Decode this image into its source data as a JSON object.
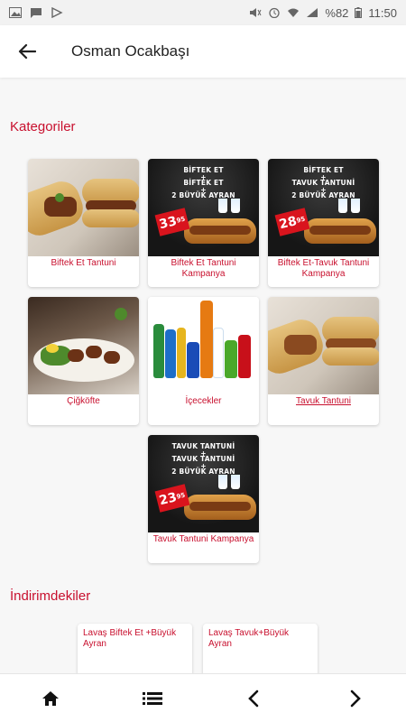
{
  "status_bar": {
    "battery_text": "%82",
    "time": "11:50",
    "left_icons": [
      "image-icon",
      "message-icon",
      "play-store-icon"
    ],
    "right_icons": [
      "mute-icon",
      "alarm-icon",
      "wifi-icon",
      "signal-icon",
      "battery-icon"
    ]
  },
  "app_bar": {
    "title": "Osman Ocakbaşı",
    "back_icon": "back-arrow-icon"
  },
  "categories": {
    "title": "Kategoriler",
    "items": [
      {
        "label": "Biftek Et Tantuni",
        "image": "wrap-and-sandwich-photo"
      },
      {
        "label": "Biftek Et Tantuni Kampanya",
        "image": "promo-poster",
        "promo": {
          "lines": [
            "BİFTEK ET",
            "+",
            "BİFTEK ET",
            "+",
            "2 BÜYÜK AYRAN"
          ],
          "price": "33",
          "price_cents": "95"
        }
      },
      {
        "label": "Biftek Et-Tavuk Tantuni Kampanya",
        "image": "promo-poster",
        "promo": {
          "lines": [
            "BİFTEK ET",
            "+",
            "TAVUK TANTUNİ",
            "+",
            "2 BÜYÜK AYRAN"
          ],
          "price": "28",
          "price_cents": "95"
        }
      },
      {
        "label": "Çiğköfte",
        "image": "cigkofte-photo"
      },
      {
        "label": "İçecekler",
        "image": "drinks-photo"
      },
      {
        "label": "Tavuk Tantuni",
        "image": "wrap-and-sandwich-photo"
      },
      {
        "label": "Tavuk Tantuni Kampanya",
        "image": "promo-poster",
        "promo": {
          "lines": [
            "TAVUK TANTUNİ",
            "+",
            "TAVUK TANTUNİ",
            "+",
            "2 BÜYÜK AYRAN"
          ],
          "price": "23",
          "price_cents": "95"
        }
      }
    ]
  },
  "discounts": {
    "title": "İndirimdekiler",
    "items": [
      {
        "label": "Lavaş Biftek Et +Büyük Ayran"
      },
      {
        "label": "Lavaş Tavuk+Büyük Ayran"
      }
    ]
  },
  "bottom_nav": {
    "items": [
      "home-icon",
      "menu-list-icon",
      "chevron-left-icon",
      "chevron-right-icon"
    ]
  },
  "colors": {
    "accent": "#c8102e",
    "price_badge": "#d9141d",
    "background": "#f7f7f7"
  }
}
